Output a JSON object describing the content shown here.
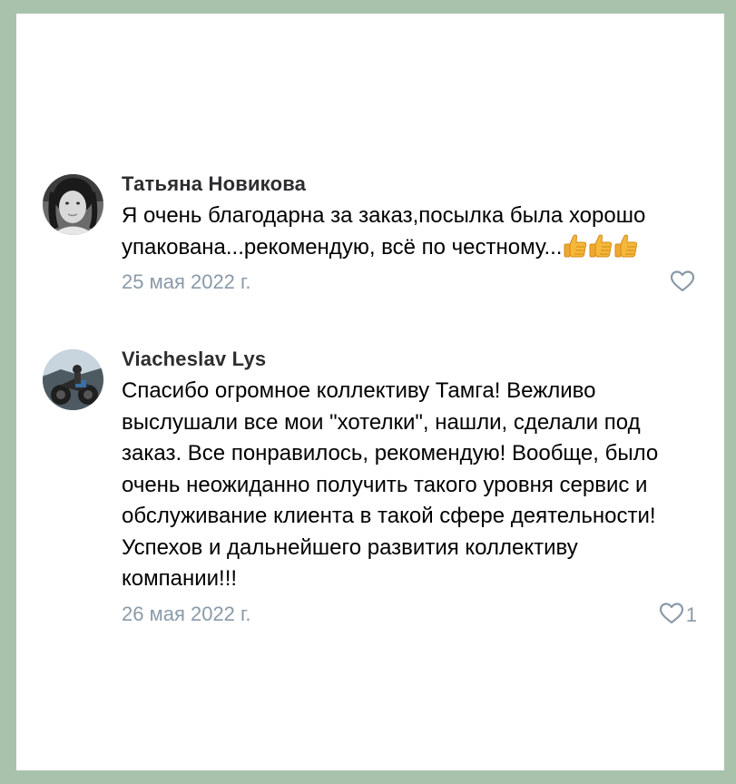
{
  "comments": [
    {
      "author": "Татьяна Новикова",
      "text": "Я очень благодарна за заказ,посылка была хорошо упакована...рекомендую, всё по честному...",
      "emojis": [
        "thumbs-up-icon",
        "thumbs-up-icon",
        "thumbs-up-icon"
      ],
      "date": "25 мая 2022 г.",
      "likes": ""
    },
    {
      "author": "Viacheslav Lys",
      "text": "Спасибо огромное коллективу Тамга! Вежливо выслушали все мои \"хотелки\", нашли, сделали под заказ. Все понравилось, рекомендую! Вообще, было очень неожиданно получить такого уровня сервис и обслуживание клиента в такой сфере деятельности! Успехов и дальнейшего развития коллективу компании!!!",
      "emojis": [],
      "date": "26 мая 2022 г.",
      "likes": "1"
    }
  ],
  "colors": {
    "border": "#a9c2ab",
    "author": "#2c2d2e",
    "meta": "#8a9aa8"
  }
}
